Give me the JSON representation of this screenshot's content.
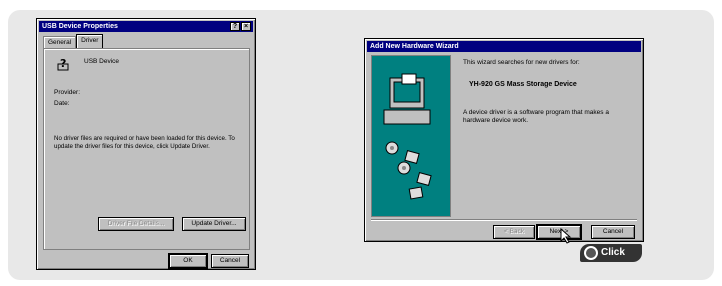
{
  "usb_window": {
    "title": "USB Device Properties",
    "title_buttons": [
      "?",
      "×"
    ],
    "tabs": [
      "General",
      "Driver"
    ],
    "device_name": "USB Device",
    "provider_label": "Provider:",
    "date_label": "Date:",
    "description": "No driver files are required or have been loaded for this device. To update the driver files for this device, click Update Driver.",
    "driver_file_details_label": "Driver File Details...",
    "update_driver_label": "Update Driver...",
    "ok_label": "OK",
    "cancel_label": "Cancel"
  },
  "wizard": {
    "title": "Add New Hardware Wizard",
    "line1": "This wizard searches for new drivers for:",
    "device": "YH-920 GS Mass Storage Device",
    "line2": "A device driver is a software program that makes a hardware device work.",
    "back_label": "< Back",
    "next_label": "Next >",
    "cancel_label": "Cancel"
  },
  "callout": {
    "label": "Click"
  },
  "colors": {
    "titlebar": "#000080",
    "wizard_art": "#008080",
    "window_face": "#c0c0c0"
  }
}
